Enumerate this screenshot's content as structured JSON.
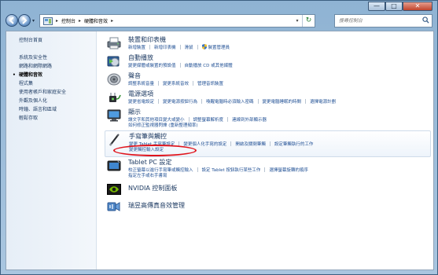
{
  "window": {
    "minimize_label": "—",
    "maximize_label": "□",
    "close_label": "✕"
  },
  "navigation": {
    "back_icon": "back-arrow-icon",
    "forward_icon": "forward-arrow-icon",
    "dropdown_glyph": "▾"
  },
  "address_bar": {
    "segments": [
      "控制台",
      "硬體和音效"
    ],
    "separator": "▸",
    "refresh_glyph": "↻"
  },
  "search": {
    "placeholder": "搜尋控制台"
  },
  "sidebar": {
    "home": "控制台首頁",
    "items": [
      "系統及安全性",
      "網路和網際網路",
      "硬體和音效",
      "程式集",
      "使用者帳戶和家庭安全",
      "外觀及個人化",
      "時鐘、語言和區域",
      "輕鬆存取"
    ],
    "current_index": 2
  },
  "categories": {
    "devices": {
      "title": "裝置和印表機",
      "icon": "printer-icon",
      "links": [
        "新增裝置",
        "新增印表機",
        "滑鼠",
        "裝置管理員"
      ]
    },
    "autoplay": {
      "title": "自動播放",
      "icon": "autoplay-icon",
      "links": [
        "變更媒體或裝置的預設值",
        "自動播放 CD 或其他媒體"
      ]
    },
    "sound": {
      "title": "聲音",
      "icon": "speaker-icon",
      "links": [
        "調整系統音量",
        "變更系統音效",
        "管理音訊裝置"
      ]
    },
    "power": {
      "title": "電源選項",
      "icon": "power-icon",
      "links": [
        "變更省電設定",
        "變更電源按鈕行為",
        "喚醒電腦時必須輸入密碼",
        "變更電腦睡眠的時間",
        "選擇電源計劃"
      ]
    },
    "display": {
      "title": "顯示",
      "icon": "display-icon",
      "links": [
        "讓文字和其他項目變大或變小",
        "調整螢幕解析度",
        "連線到外部顯示器"
      ],
      "links_row2": [
        "如何修正監視器閃爍 (重新整理頻率)"
      ]
    },
    "pen": {
      "title": "手寫筆與觸控",
      "icon": "pen-icon",
      "links": [
        "變更 Tablet 手寫筆設定",
        "變更個人化手寫的設定",
        "開啟及關閉筆觸",
        "設定筆觸執行的工作"
      ],
      "links_row2": [
        "變更觸控輸入設定"
      ]
    },
    "tablet": {
      "title": "Tablet PC 設定",
      "icon": "tablet-icon",
      "links": [
        "校正螢幕以進行手寫筆或觸控輸入",
        "設定 Tablet 按鈕執行某些工作",
        "選擇螢幕旋轉的順序"
      ],
      "links_row2": [
        "指定左手或右手書寫"
      ]
    },
    "nvidia": {
      "title": "NVIDIA 控制面板",
      "icon": "nvidia-icon"
    },
    "realtek": {
      "title": "瑞昱高傳真音效管理",
      "icon": "realtek-audio-icon"
    }
  },
  "colors": {
    "link": "#1f4f94",
    "title": "#1e3b63",
    "annotation": "#e0141c"
  }
}
